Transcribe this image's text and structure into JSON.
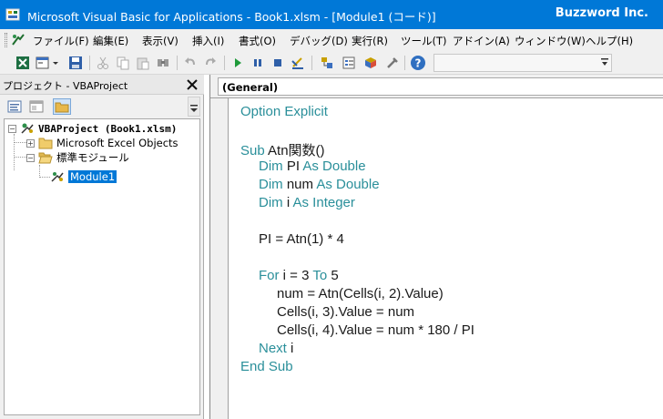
{
  "window": {
    "title": "Microsoft Visual Basic for Applications - Book1.xlsm - [Module1 (コード)]",
    "brand": "Buzzword Inc."
  },
  "menu": {
    "items": [
      "ファイル(F)",
      "編集(E)",
      "表示(V)",
      "挿入(I)",
      "書式(O)",
      "デバッグ(D)",
      "実行(R)",
      "ツール(T)",
      "アドイン(A)",
      "ウィンドウ(W)",
      "ヘルプ(H)"
    ]
  },
  "toolbar": {
    "buttons": [
      "excel-icon",
      "insert-userform-icon",
      "save-icon",
      "cut-icon",
      "copy-icon",
      "paste-icon",
      "find-icon",
      "undo-icon",
      "redo-icon",
      "run-icon",
      "pause-icon",
      "reset-icon",
      "design-mode-icon",
      "project-explorer-icon",
      "properties-icon",
      "object-browser-icon",
      "toolbox-icon",
      "help-icon"
    ]
  },
  "project_panel": {
    "title": "プロジェクト - VBAProject",
    "tree": {
      "root": "VBAProject (Book1.xlsm)",
      "excel_objects": "Microsoft Excel Objects",
      "modules_folder": "標準モジュール",
      "module": "Module1"
    }
  },
  "code_window": {
    "object_combo": "(General)",
    "lines": [
      {
        "kw": "Option Explicit",
        "rest": ""
      },
      {
        "kw": "",
        "rest": ""
      },
      {
        "kw": "Sub ",
        "rest": "Atn関数()"
      },
      {
        "kw": "",
        "rest": "Dim PI",
        "kw2": " As Double"
      },
      {
        "kw": "",
        "rest": "Dim num",
        "kw2": " As Double"
      },
      {
        "kw": "",
        "rest": "Dim i",
        "kw2": " As Integer"
      },
      {
        "kw": "",
        "rest": ""
      },
      {
        "kw": "",
        "rest": "PI = Atn(1) * 4"
      },
      {
        "kw": "",
        "rest": ""
      },
      {
        "kw": "For",
        "rest": " i = 3 ",
        "kw2": "To",
        "rest2": " 5"
      },
      {
        "kw": "",
        "rest": "num = Atn(Cells(i, 2).Value)"
      },
      {
        "kw": "",
        "rest": "Cells(i, 3).Value = num"
      },
      {
        "kw": "",
        "rest": "Cells(i, 4).Value = num * 180 / PI"
      },
      {
        "kw": "Next",
        "rest": " i"
      },
      {
        "kw": "End Sub",
        "rest": ""
      }
    ]
  }
}
